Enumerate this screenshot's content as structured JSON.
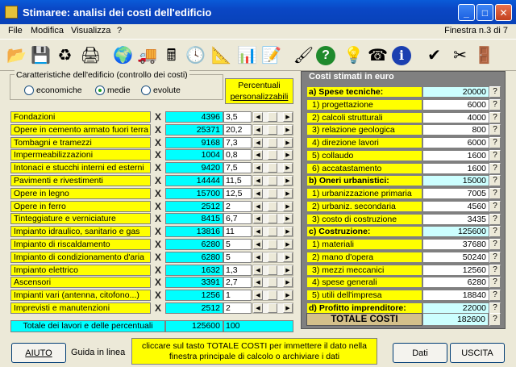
{
  "window": {
    "title": "Stimaree: analisi dei costi dell'edificio",
    "minimize": "_",
    "maximize": "□",
    "close": "✕"
  },
  "menu": {
    "items": [
      "File",
      "Modifica",
      "Visualizza",
      "?"
    ],
    "window_counter": "Finestra n.3 di 7"
  },
  "toolbar": {
    "icons": [
      "open-folder-icon",
      "save-disk-icon",
      "recycle-bin-icon",
      "printer-icon",
      "globe-icon",
      "truck-icon",
      "calculator-icon",
      "clock-icon",
      "level-icon",
      "chart-icon",
      "notepad-icon",
      "brush-icon",
      "help-icon",
      "lightbulb-icon",
      "telephone-icon",
      "info-icon",
      "spellcheck-icon",
      "scissors-icon",
      "exit-door-icon"
    ],
    "glyphs": [
      "📂",
      "💾",
      "♻",
      "🖨",
      "🌍",
      "🚚",
      "🖩",
      "🕓",
      "📐",
      "📊",
      "📝",
      "🖌",
      "?",
      "💡",
      "☎",
      "i",
      "✔",
      "✂",
      "🚪"
    ]
  },
  "characteristics": {
    "legend": "Caratteristiche dell'edificio (controllo dei costi)",
    "options": [
      "economiche",
      "medie",
      "evolute"
    ],
    "selected": "medie"
  },
  "percent_header": [
    "Percentuali",
    "personalizzabili"
  ],
  "remove_glyph": "X",
  "works": [
    {
      "label": "Fondazioni",
      "value": "4396",
      "pct": "3,5"
    },
    {
      "label": "Opere in cemento armato fuori terra",
      "value": "25371",
      "pct": "20,2"
    },
    {
      "label": "Tombagni e tramezzi",
      "value": "9168",
      "pct": "7,3"
    },
    {
      "label": "Impermeabilizzazioni",
      "value": "1004",
      "pct": "0,8"
    },
    {
      "label": "Intonaci e stucchi interni ed esterni",
      "value": "9420",
      "pct": "7,5"
    },
    {
      "label": "Pavimenti e rivestimenti",
      "value": "14444",
      "pct": "11,5"
    },
    {
      "label": "Opere in legno",
      "value": "15700",
      "pct": "12,5"
    },
    {
      "label": "Opere in ferro",
      "value": "2512",
      "pct": "2"
    },
    {
      "label": "Tinteggiature e verniciature",
      "value": "8415",
      "pct": "6,7"
    },
    {
      "label": "Impianto idraulico, sanitario e gas",
      "value": "13816",
      "pct": "11"
    },
    {
      "label": "Impianto di riscaldamento",
      "value": "6280",
      "pct": "5"
    },
    {
      "label": "Impianto di condizionamento d'aria",
      "value": "6280",
      "pct": "5"
    },
    {
      "label": "Impianto elettrico",
      "value": "1632",
      "pct": "1,3"
    },
    {
      "label": "Ascensori",
      "value": "3391",
      "pct": "2,7"
    },
    {
      "label": "Impianti vari (antenna, citofono...)",
      "value": "1256",
      "pct": "1"
    },
    {
      "label": "Imprevisti e manutenzioni",
      "value": "2512",
      "pct": "2"
    }
  ],
  "totals": {
    "label": "Totale dei lavori e delle percentuali",
    "value": "125600",
    "pct": "100"
  },
  "costs": {
    "title": "Costi stimati in euro",
    "help_glyph": "?",
    "rows": [
      {
        "label": "a) Spese tecniche:",
        "value": "20000",
        "header": true
      },
      {
        "label": "1) progettazione",
        "value": "6000",
        "header": false
      },
      {
        "label": "2) calcoli strutturali",
        "value": "4000",
        "header": false
      },
      {
        "label": "3) relazione geologica",
        "value": "800",
        "header": false
      },
      {
        "label": "4) direzione lavori",
        "value": "6000",
        "header": false
      },
      {
        "label": "5) collaudo",
        "value": "1600",
        "header": false
      },
      {
        "label": "6) accatastamento",
        "value": "1600",
        "header": false
      },
      {
        "label": "b) Oneri urbanistici:",
        "value": "15000",
        "header": true
      },
      {
        "label": "1) urbanizzazione primaria",
        "value": "7005",
        "header": false
      },
      {
        "label": "2) urbaniz. secondaria",
        "value": "4560",
        "header": false
      },
      {
        "label": "3) costo di costruzione",
        "value": "3435",
        "header": false
      },
      {
        "label": "c) Costruzione:",
        "value": "125600",
        "header": true
      },
      {
        "label": "1) materiali",
        "value": "37680",
        "header": false
      },
      {
        "label": "2) mano d'opera",
        "value": "50240",
        "header": false
      },
      {
        "label": "3) mezzi meccanici",
        "value": "12560",
        "header": false
      },
      {
        "label": "4) spese generali",
        "value": "6280",
        "header": false
      },
      {
        "label": "5) utili dell'impresa",
        "value": "18840",
        "header": false
      },
      {
        "label": "d) Profitto imprenditore:",
        "value": "22000",
        "header": true
      }
    ],
    "total_label": "TOTALE COSTI",
    "total_value": "182600"
  },
  "bottom": {
    "aiuto": "AIUTO",
    "guida": "Guida in linea",
    "info": "cliccare sul tasto TOTALE COSTI per immettere il dato nella finestra principale di calcolo o archiviare i dati",
    "dati": "Dati",
    "uscita": "USCITA"
  },
  "colors": {
    "label_bg": "#ffff00",
    "value_bg": "#00ffff",
    "panel_bg": "#808080",
    "titlebar": "#0a46c4"
  }
}
